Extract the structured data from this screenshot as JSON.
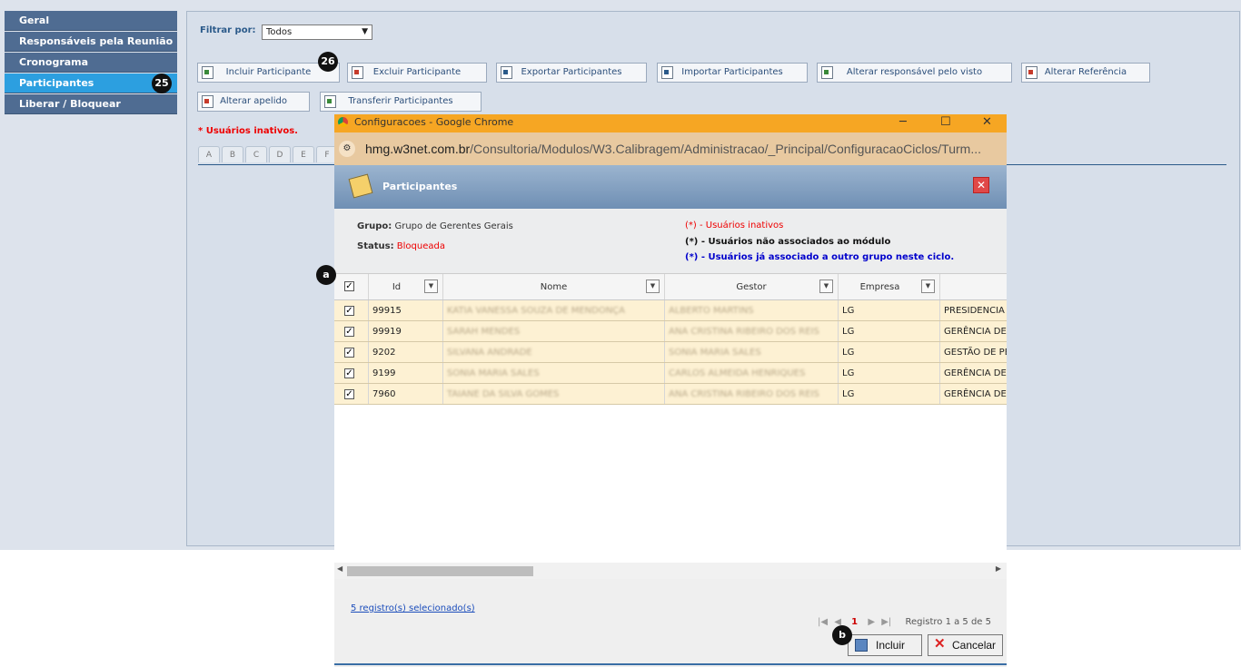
{
  "sidebar": {
    "items": [
      {
        "label": "Geral"
      },
      {
        "label": "Responsáveis pela Reunião"
      },
      {
        "label": "Cronograma"
      },
      {
        "label": "Participantes"
      },
      {
        "label": "Liberar / Bloquear"
      }
    ],
    "badge": "25"
  },
  "main": {
    "filter_label": "Filtrar por:",
    "filter_value": "Todos",
    "buttons": {
      "incluir": "Incluir Participante",
      "excluir": "Excluir Participante",
      "exportar": "Exportar Participantes",
      "importar": "Importar Participantes",
      "alterar_responsavel": "Alterar responsável pelo visto",
      "alterar_referencia": "Alterar Referência",
      "alterar_apelido": "Alterar apelido",
      "transferir": "Transferir Participantes"
    },
    "badge": "26",
    "inativos": "* Usuários inativos.",
    "letters": [
      "A",
      "B",
      "C",
      "D",
      "E",
      "F"
    ]
  },
  "popup": {
    "window_title": "Configuracoes - Google Chrome",
    "url_host": "hmg.w3net.com.br",
    "url_path": "/Consultoria/Modulos/W3.Calibragem/Administracao/_Principal/ConfiguracaoCiclos/Turm...",
    "dialog_title": "Participantes",
    "grupo_label": "Grupo:",
    "grupo_value": "Grupo de Gerentes Gerais",
    "status_label": "Status:",
    "status_value": "Bloqueada",
    "legend_red": "(*) - Usuários inativos",
    "legend_black": "(*) - Usuários não associados ao módulo",
    "legend_blue": "(*) - Usuários já associado a outro grupo neste ciclo.",
    "badge_a": "a",
    "columns": [
      "Id",
      "Nome",
      "Gestor",
      "Empresa"
    ],
    "rows": [
      {
        "id": "99915",
        "nome": "KATIA VANESSA SOUZA DE MENDONÇA",
        "gestor": "ALBERTO MARTINS",
        "empresa": "LG",
        "area": "PRESIDENCIA"
      },
      {
        "id": "99919",
        "nome": "SARAH MENDES",
        "gestor": "ANA CRISTINA RIBEIRO DOS REIS",
        "empresa": "LG",
        "area": "GERÊNCIA DE"
      },
      {
        "id": "9202",
        "nome": "SILVANA ANDRADE",
        "gestor": "SONIA MARIA SALES",
        "empresa": "LG",
        "area": "GESTÃO DE PE"
      },
      {
        "id": "9199",
        "nome": "SONIA MARIA SALES",
        "gestor": "CARLOS ALMEIDA HENRIQUES",
        "empresa": "LG",
        "area": "GERÊNCIA DE"
      },
      {
        "id": "7960",
        "nome": "TAIANE DA SILVA GOMES",
        "gestor": "ANA CRISTINA RIBEIRO DOS REIS",
        "empresa": "LG",
        "area": "GERÊNCIA DE"
      }
    ],
    "selected_link": "5 registro(s) selecionado(s)",
    "page_current": "1",
    "registro": "Registro 1 a 5 de 5",
    "badge_b": "b",
    "incluir": "Incluir",
    "cancelar": "Cancelar"
  }
}
